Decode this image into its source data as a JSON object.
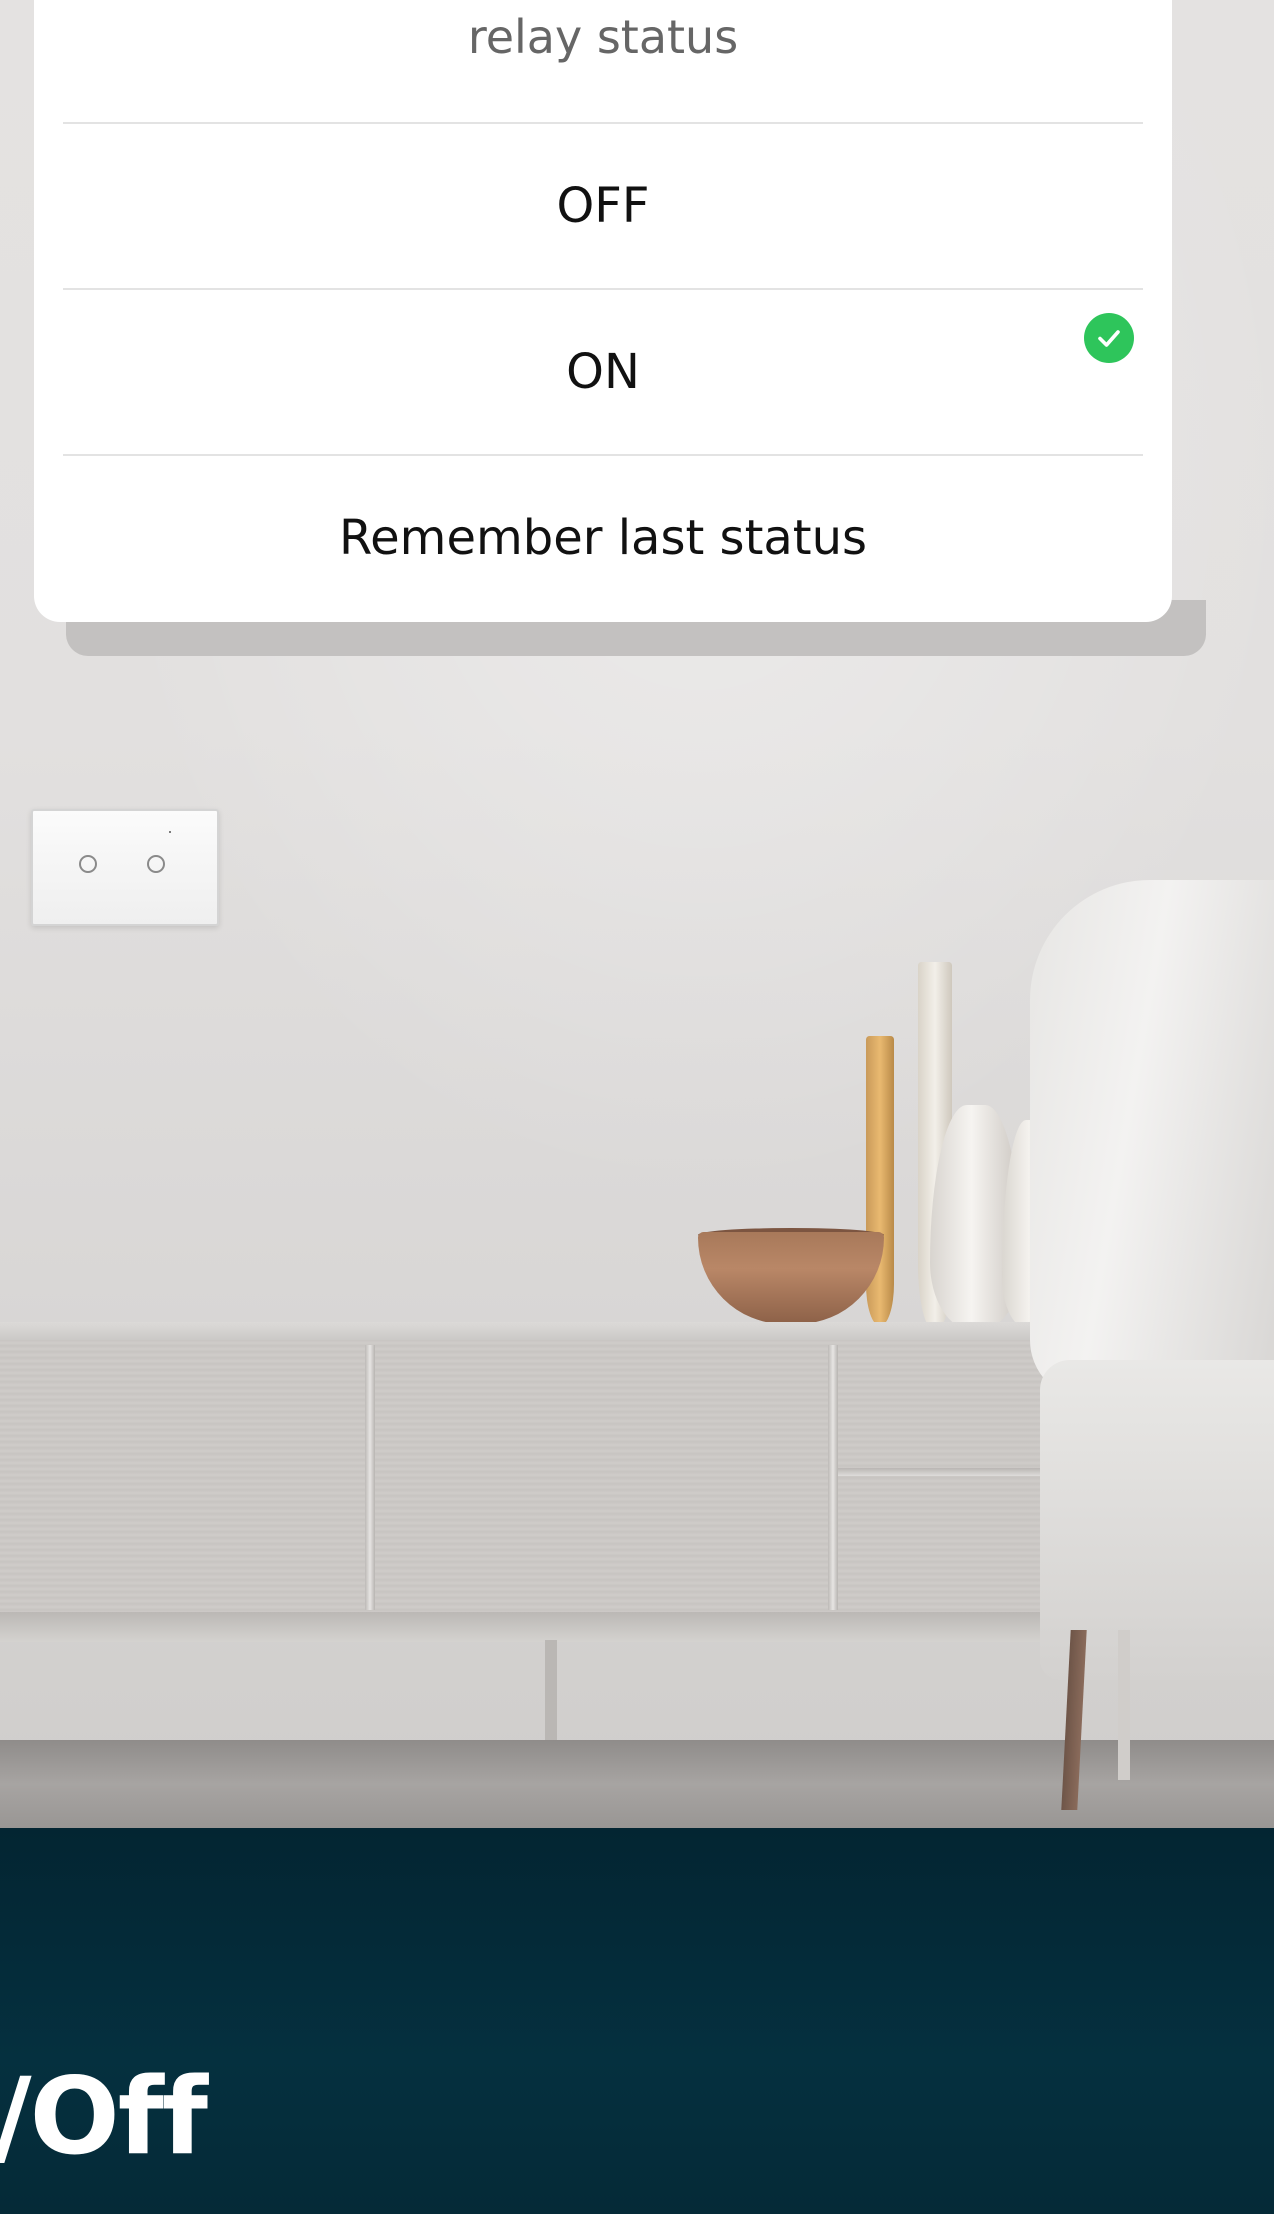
{
  "relay_dialog": {
    "title": "relay status",
    "options": [
      {
        "label": "OFF",
        "selected": false
      },
      {
        "label": "ON",
        "selected": true
      },
      {
        "label": "Remember last status",
        "selected": false
      }
    ],
    "check_color": "#2ec55b"
  },
  "banner": {
    "text": "n/Off",
    "background_color": "#04303f"
  },
  "icons": {
    "selected_indicator": "check-circle-icon"
  }
}
